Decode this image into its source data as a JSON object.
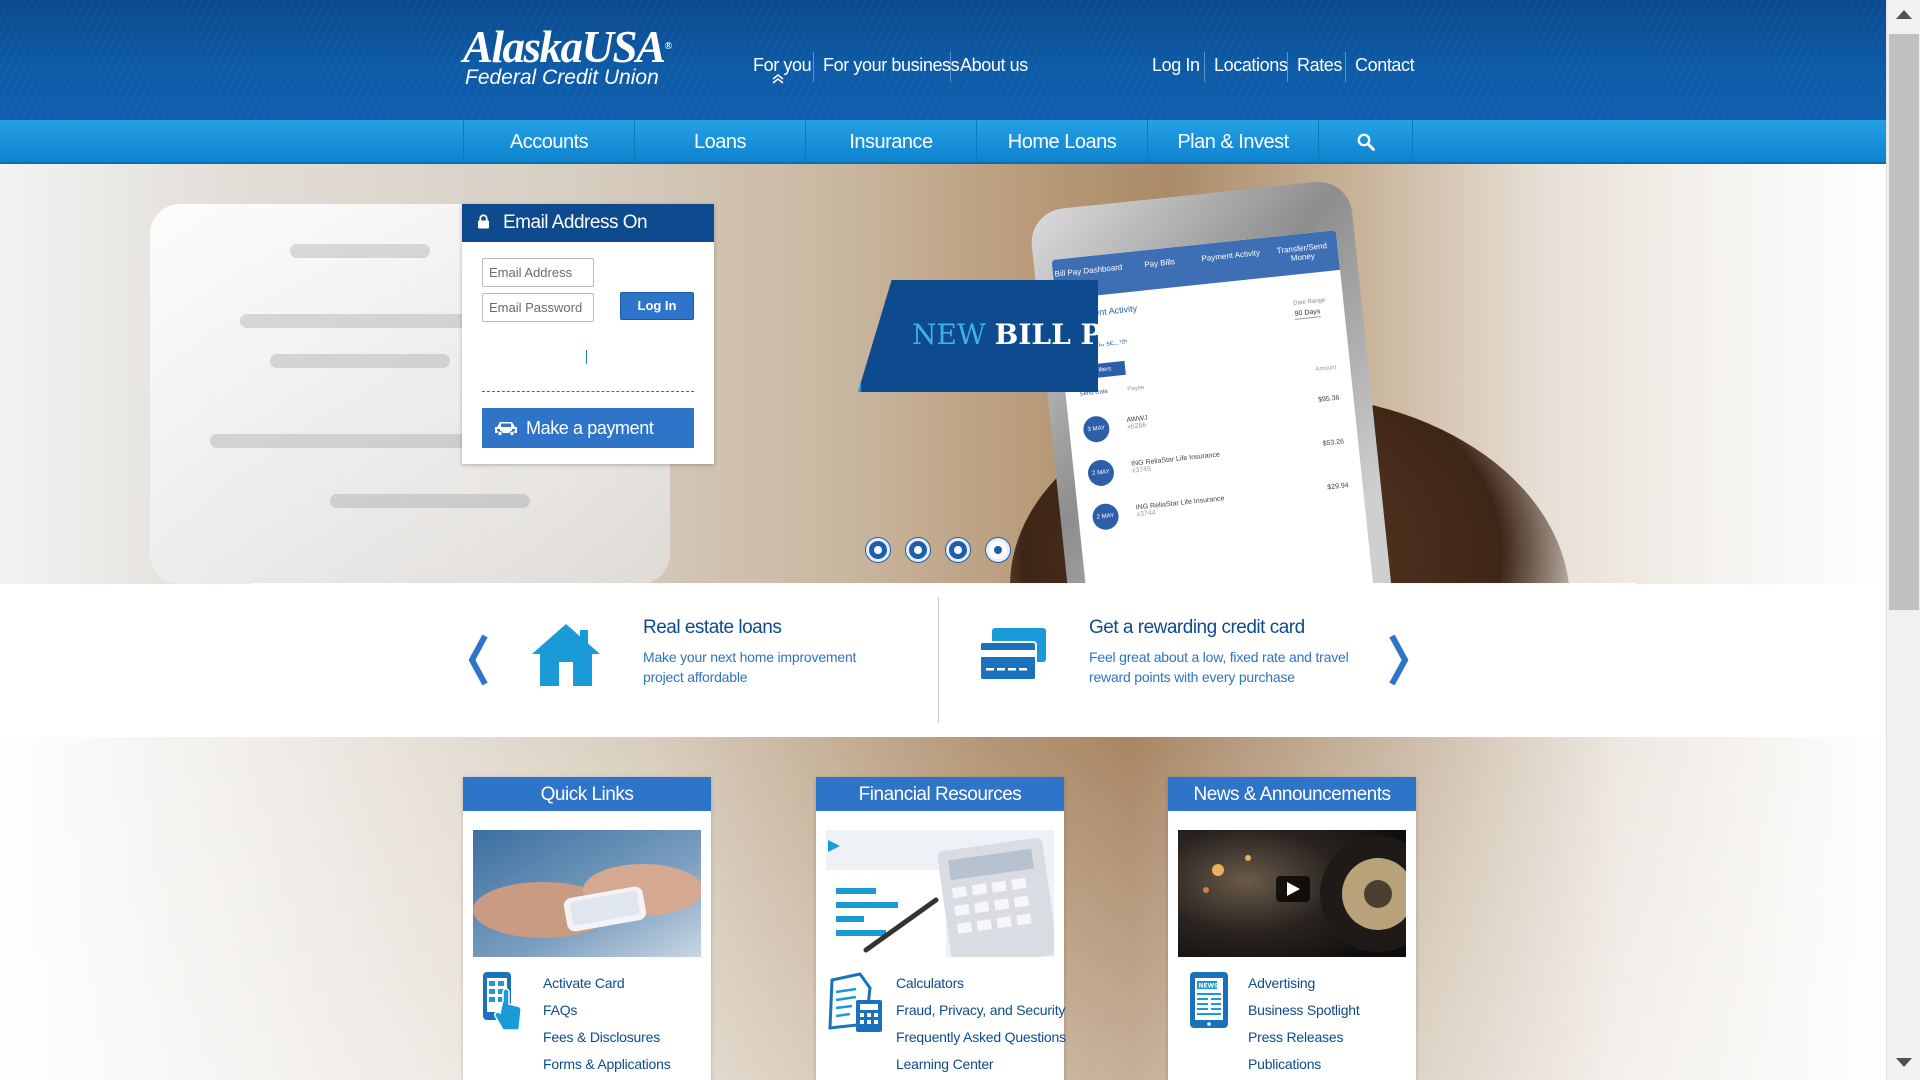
{
  "brand": {
    "logo_main": "AlaskaUSA",
    "logo_mark": "®",
    "logo_sub": "Federal Credit Union"
  },
  "top_nav": {
    "primary": [
      "For you",
      "For your business",
      "About us"
    ],
    "active": "For you",
    "utility": [
      "Log In",
      "Locations",
      "Rates",
      "Contact"
    ]
  },
  "main_nav": {
    "items": [
      "Accounts",
      "Loans",
      "Insurance",
      "Home Loans",
      "Plan & Invest"
    ],
    "search_icon": "search-icon"
  },
  "login": {
    "title": "Email Address On Account",
    "email_placeholder": "Email Address",
    "password_placeholder": "Email Password",
    "login_button": "Log In",
    "payment_button": "Make a payment"
  },
  "hero": {
    "banner_new": "NEW",
    "banner_main": "BILL PAY",
    "slides_total": 4,
    "active_slide": 4,
    "phone": {
      "tabs": [
        "Bill Pay Dashboard",
        "Pay Bills",
        "Payment Activity",
        "Transfer/Send Money"
      ],
      "heading": "Payment Activity",
      "date_range_label": "Date Range",
      "date_range_value": "90 Days",
      "search_hint": "to search",
      "filter_button": "Filters",
      "col_send_date": "Send Date",
      "col_payee": "Payee",
      "col_amount": "Amount",
      "rows": [
        {
          "day": "3",
          "month": "MAY",
          "payee": "AWWJ",
          "acct": "x6286",
          "amount": "$95.36"
        },
        {
          "day": "2",
          "month": "MAY",
          "payee": "ING ReliaStar Life Insurance",
          "acct": "x3745",
          "amount": "$53.26"
        },
        {
          "day": "2",
          "month": "MAY",
          "payee": "ING ReliaStar Life Insurance",
          "acct": "x3744",
          "amount": "$29.94"
        }
      ]
    }
  },
  "promos": [
    {
      "title": "Real estate loans",
      "description": "Make your next home improvement project affordable",
      "icon": "house-icon"
    },
    {
      "title": "Get a rewarding credit card",
      "description": "Feel great about a low, fixed rate and travel reward points with every purchase",
      "icon": "credit-card-icon"
    }
  ],
  "cards": [
    {
      "title": "Quick Links",
      "icon": "touch-phone-icon",
      "links": [
        "Activate Card",
        "FAQs",
        "Fees & Disclosures",
        "Forms & Applications"
      ]
    },
    {
      "title": "Financial Resources",
      "icon": "calculator-document-icon",
      "links": [
        "Calculators",
        "Fraud, Privacy, and Security",
        "Frequently Asked Questions",
        "Learning Center"
      ]
    },
    {
      "title": "News & Announcements",
      "icon": "newspaper-tablet-icon",
      "links": [
        "Advertising",
        "Business Spotlight",
        "Press Releases",
        "Publications"
      ]
    }
  ],
  "colors": {
    "header_dark": "#0d4b8e",
    "nav_blue": "#1b95dc",
    "button_blue": "#2e74c8",
    "link_blue": "#2f74c0"
  }
}
